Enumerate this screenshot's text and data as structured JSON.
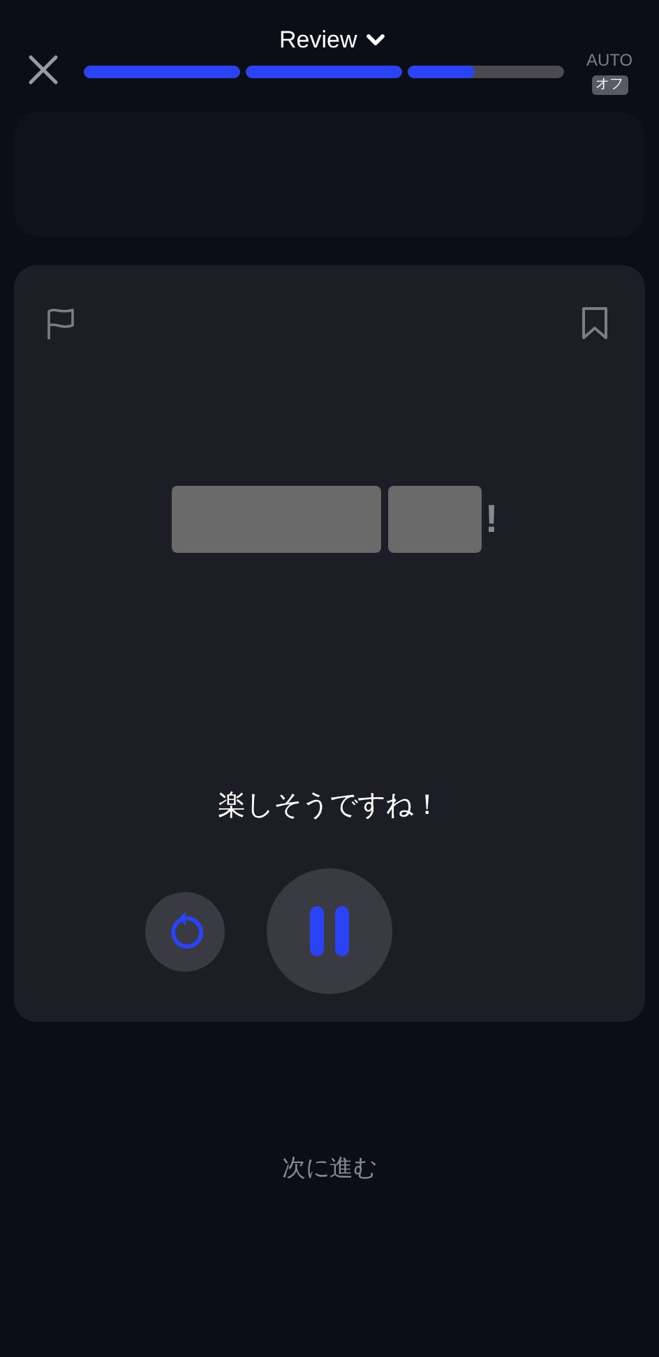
{
  "header": {
    "title": "Review",
    "progress": [
      {
        "level": 1
      },
      {
        "level": 1
      },
      {
        "level": 0.43
      }
    ],
    "auto": {
      "label": "AUTO",
      "value": "オフ"
    }
  },
  "card": {
    "answer": [
      {
        "kind": "long_blank"
      },
      {
        "kind": "short_blank"
      },
      {
        "kind": "text",
        "text": "!"
      }
    ],
    "sentence": "楽しそうですね！"
  },
  "next_button": "次に進む"
}
